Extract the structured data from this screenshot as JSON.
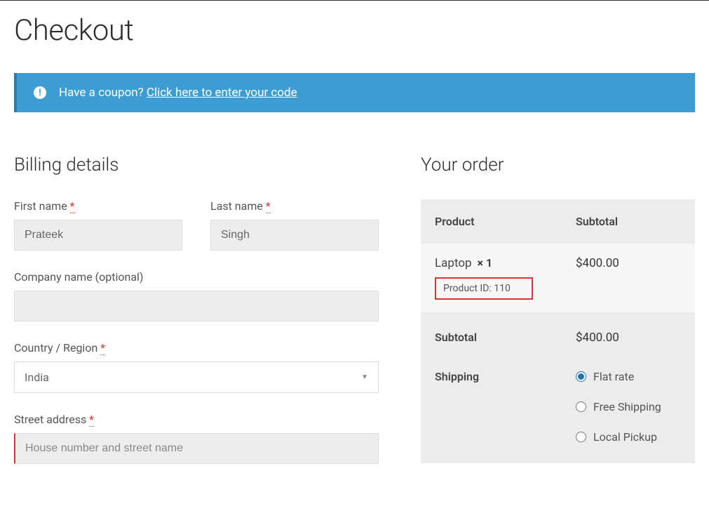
{
  "page": {
    "title": "Checkout"
  },
  "coupon": {
    "prompt": "Have a coupon? ",
    "link": "Click here to enter your code"
  },
  "billing": {
    "heading": "Billing details",
    "first_name_label": "First name",
    "first_name_value": "Prateek",
    "last_name_label": "Last name",
    "last_name_value": "Singh",
    "company_label": "Company name (optional)",
    "company_value": "",
    "country_label": "Country / Region",
    "country_value": "India",
    "street_label": "Street address",
    "street_placeholder": "House number and street name",
    "required_mark": "*"
  },
  "order": {
    "heading": "Your order",
    "col_product": "Product",
    "col_subtotal": "Subtotal",
    "item": {
      "name": "Laptop",
      "qty_text": "×  1",
      "price": "$400.00",
      "product_id_label": "Product ID: 110"
    },
    "subtotal_label": "Subtotal",
    "subtotal_value": "$400.00",
    "shipping_label": "Shipping",
    "shipping_options": {
      "flat": "Flat rate",
      "free": "Free Shipping",
      "local": "Local Pickup"
    }
  }
}
